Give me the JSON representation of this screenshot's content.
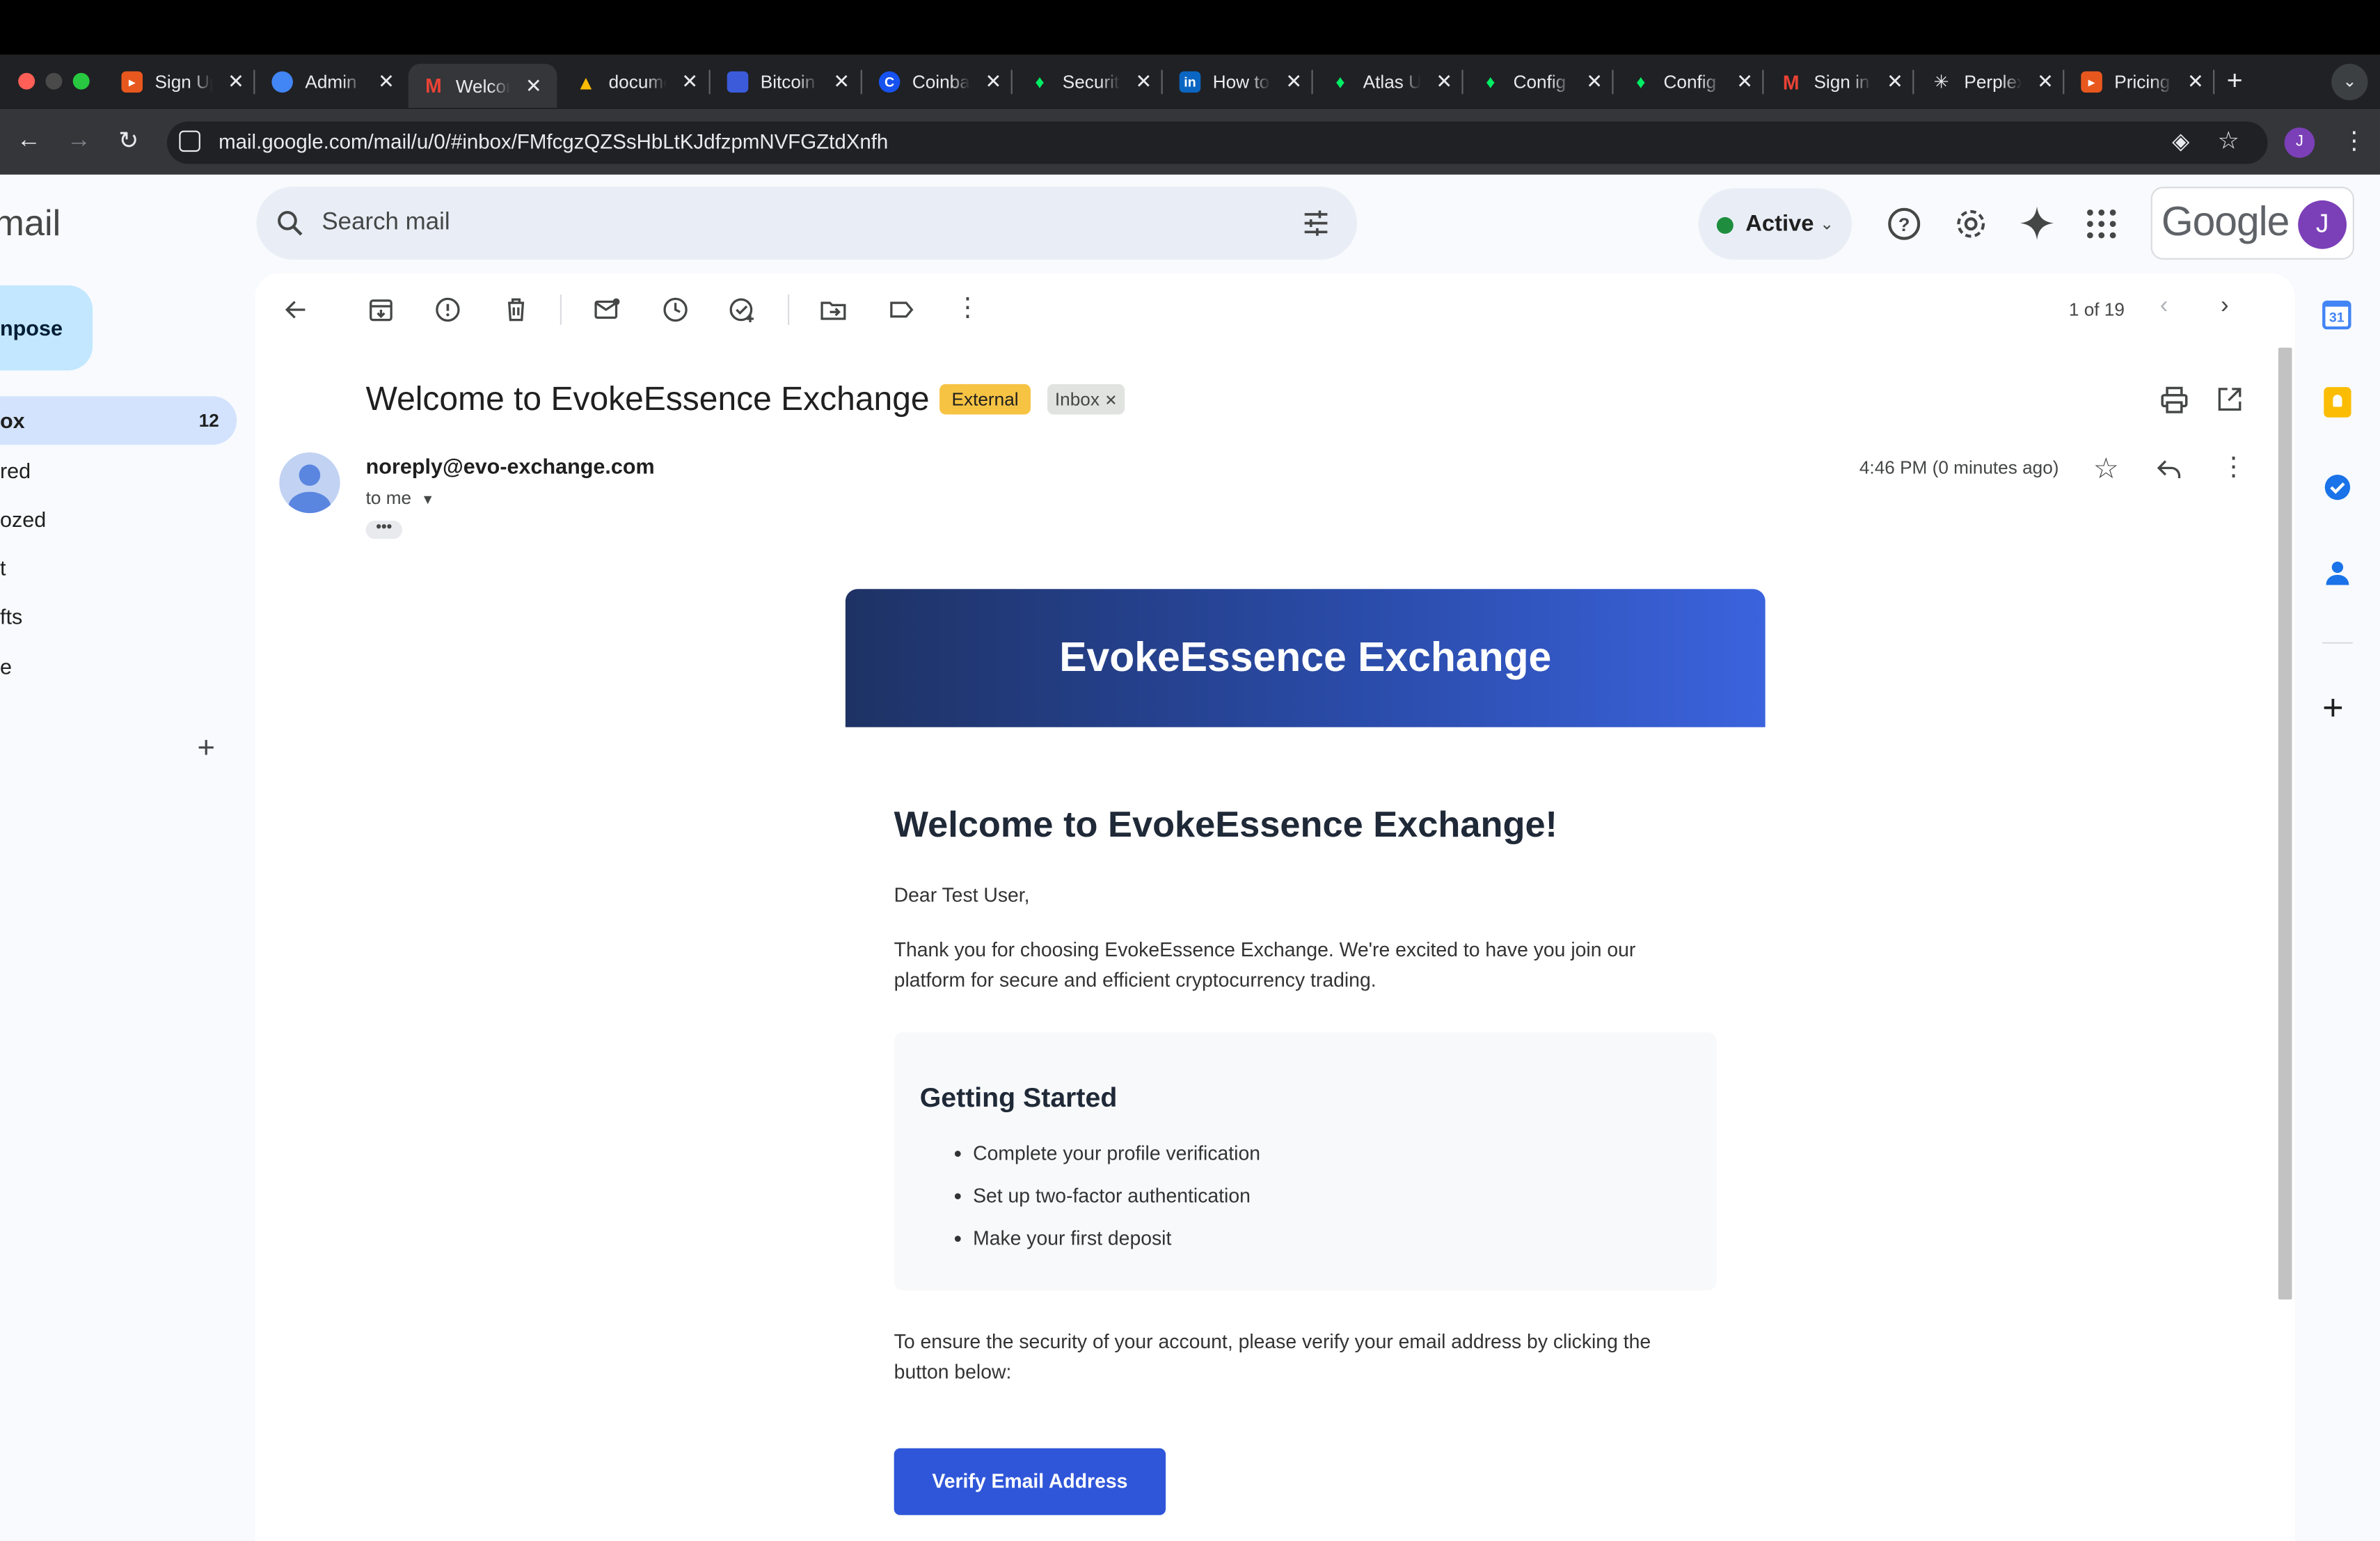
{
  "browser": {
    "tabs": [
      {
        "title": "Sign Up",
        "fav": "orange-icon"
      },
      {
        "title": "Admin",
        "fav": "blue-hex-icon"
      },
      {
        "title": "Welcome",
        "fav": "gmail-icon"
      },
      {
        "title": "document",
        "fav": "drive-icon"
      },
      {
        "title": "Bitcoin",
        "fav": "blue-square-icon"
      },
      {
        "title": "Coinbase",
        "fav": "coinbase-icon"
      },
      {
        "title": "Security",
        "fav": "mongodb-icon"
      },
      {
        "title": "How to",
        "fav": "linkedin-icon"
      },
      {
        "title": "Atlas U",
        "fav": "mongodb-icon"
      },
      {
        "title": "Config",
        "fav": "mongodb-icon"
      },
      {
        "title": "Config",
        "fav": "mongodb-icon"
      },
      {
        "title": "Sign in",
        "fav": "gmail-icon"
      },
      {
        "title": "Perplexity",
        "fav": "perplexity-icon"
      },
      {
        "title": "Pricing",
        "fav": "orange-icon"
      }
    ],
    "url": "mail.google.com/mail/u/0/#inbox/FMfcgzQZSsHbLtKJdfzpmNVFGZtdXnfh",
    "profile_initial": "J"
  },
  "gmail": {
    "logo_text": "mail",
    "search_placeholder": "Search mail",
    "status": "Active",
    "google_word": "Google",
    "avatar_initial": "J",
    "compose_label": "npose",
    "nav": [
      {
        "label": "ox",
        "count": "12"
      },
      {
        "label": "red"
      },
      {
        "label": "ozed"
      },
      {
        "label": "t"
      },
      {
        "label": "fts"
      },
      {
        "label": "e"
      }
    ],
    "pager": "1 of 19"
  },
  "email": {
    "subject": "Welcome to EvokeEssence Exchange",
    "badge_external": "External",
    "badge_inbox": "Inbox",
    "sender": "noreply@evo-exchange.com",
    "to": "to me",
    "time": "4:46 PM (0 minutes ago)",
    "banner_title": "EvokeEssence Exchange",
    "heading": "Welcome to EvokeEssence Exchange!",
    "greeting": "Dear Test User,",
    "intro_line1": "Thank you for choosing EvokeEssence Exchange. We're excited to have you join our",
    "intro_line2": "platform for secure and efficient cryptocurrency trading.",
    "getting_started_title": "Getting Started",
    "steps": [
      "Complete your profile verification",
      "Set up two-factor authentication",
      "Make your first deposit"
    ],
    "verify_line1": "To ensure the security of your account, please verify your email address by clicking the",
    "verify_line2": "button below:",
    "verify_button": "Verify Email Address"
  },
  "colors": {
    "banner_start": "#1e3264",
    "banner_end": "#3b63dd",
    "verify_button": "#2f56d9",
    "external_badge": "#f6c343",
    "compose_bg": "#c2e7ff",
    "nav_active": "#d3e3fd"
  }
}
